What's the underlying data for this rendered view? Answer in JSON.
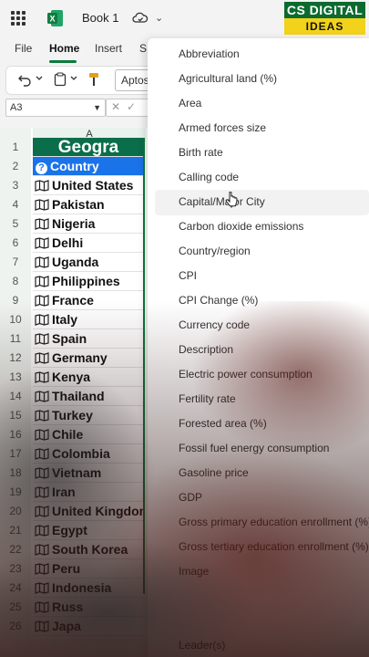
{
  "titlebar": {
    "title": "Book 1",
    "chevron": "⌄"
  },
  "logo": {
    "line1": "CS DIGITAL",
    "line2": "IDEAS"
  },
  "ribbon": {
    "tabs": [
      "File",
      "Home",
      "Insert",
      "S"
    ],
    "active_tab": "Home",
    "font_value": "Aptos"
  },
  "formula": {
    "namebox": "A3"
  },
  "sheet": {
    "column_header": "A",
    "header_text": "Geogra",
    "row_numbers": [
      "1",
      "2",
      "3",
      "4",
      "5",
      "6",
      "7",
      "8",
      "9",
      "10",
      "11",
      "12",
      "13",
      "14",
      "15",
      "16",
      "17",
      "18",
      "19",
      "20",
      "21",
      "22",
      "23",
      "24",
      "25",
      "26"
    ],
    "country_label": "Country",
    "countries": [
      "United States",
      "Pakistan",
      "Nigeria",
      "Delhi",
      "Uganda",
      "Philippines",
      "France",
      "Italy",
      "Spain",
      "Germany",
      "Kenya",
      "Thailand",
      "Turkey",
      "Chile",
      "Colombia",
      "Vietnam",
      "Iran",
      "United Kingdom",
      "Egypt",
      "South Korea",
      "Peru",
      "Indonesia",
      "Russ",
      "Japa"
    ]
  },
  "dropdown": {
    "items": [
      "Abbreviation",
      "Agricultural land (%)",
      "Area",
      "Armed forces size",
      "Birth rate",
      "Calling code",
      "Capital/Major City",
      "Carbon dioxide emissions",
      "Country/region",
      "CPI",
      "CPI Change (%)",
      "Currency code",
      "Description",
      "Electric power consumption",
      "Fertility rate",
      "Forested area (%)",
      "Fossil fuel energy consumption",
      "Gasoline price",
      "GDP",
      "Gross primary education enrollment (%)",
      "Gross tertiary education enrollment (%)",
      "Image"
    ],
    "last_item": "Leader(s)",
    "hovered_index": 6
  },
  "colors": {
    "excel_green": "#0b7a3b",
    "header_green": "#0a6e4a",
    "selection_blue": "#1a73e8"
  }
}
